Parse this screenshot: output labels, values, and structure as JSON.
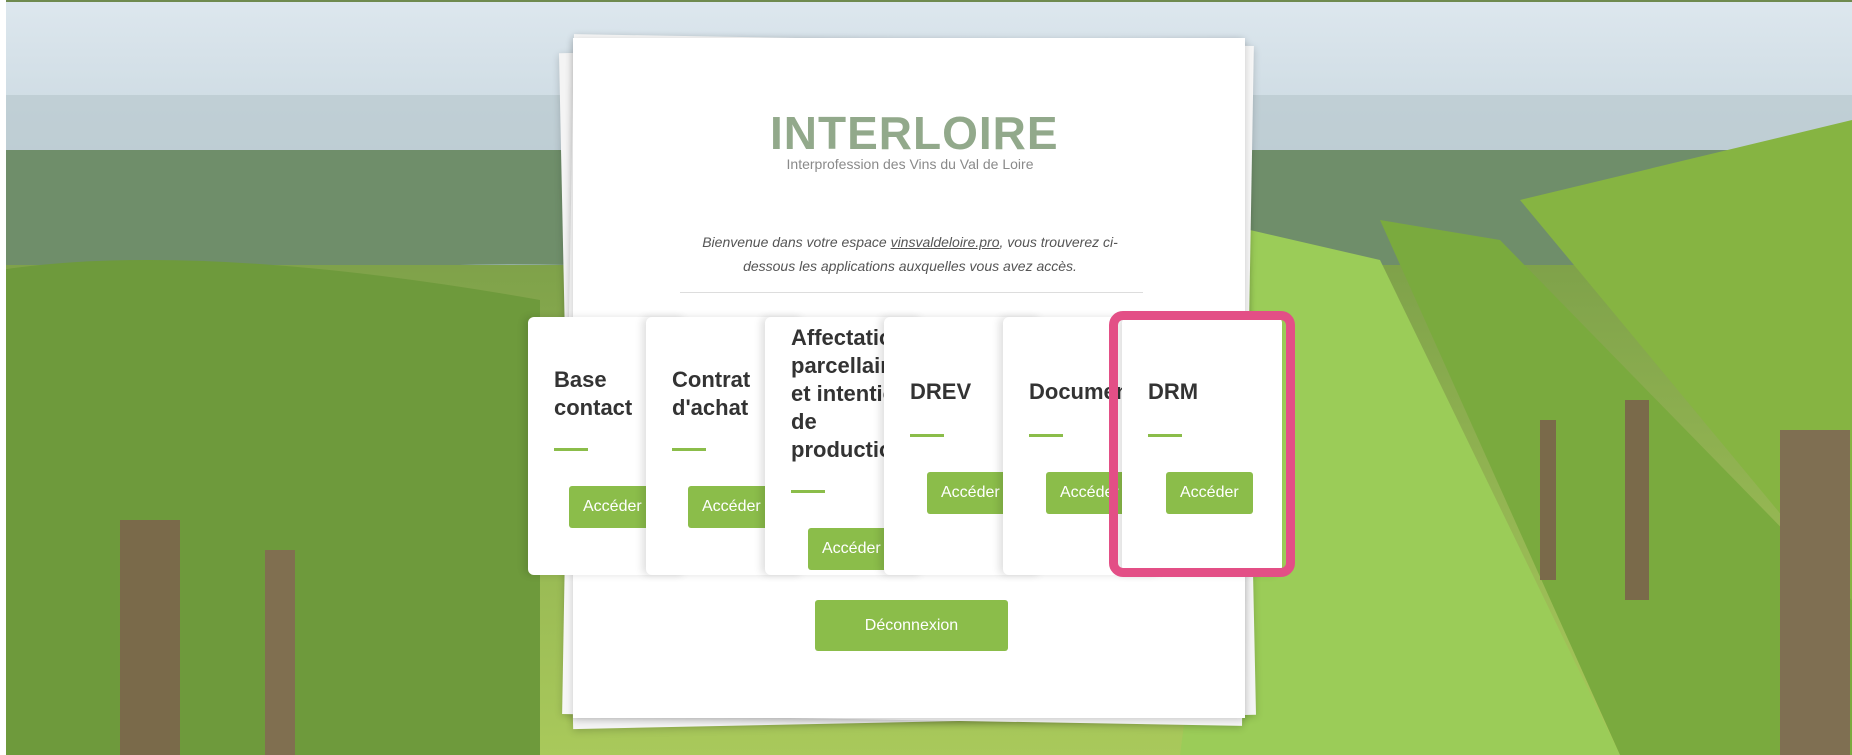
{
  "colors": {
    "accent_green": "#8bbd4a",
    "highlight_pink": "#e34f86",
    "logo_color": "#92a98b"
  },
  "logo": {
    "title": "INTERLOIRE",
    "subtitle": "Interprofession des Vins du Val de Loire"
  },
  "welcome": {
    "before": "Bienvenue dans votre espace ",
    "link": "vinsvaldeloire.pro",
    "after": ", vous trouverez ci-dessous les applications auxquelles vous avez accès."
  },
  "cards": [
    {
      "title": "Base\ncontact",
      "button": "Accéder"
    },
    {
      "title": "Contrat\nd'achat",
      "button": "Accéder"
    },
    {
      "title": "Affectation\nparcellaire\net intention\nde\nproduction",
      "button": "Accéder"
    },
    {
      "title": "DREV",
      "button": "Accéder"
    },
    {
      "title": "Documents",
      "button": "Accéder"
    },
    {
      "title": "DRM",
      "button": "Accéder"
    }
  ],
  "logout_label": "Déconnexion"
}
